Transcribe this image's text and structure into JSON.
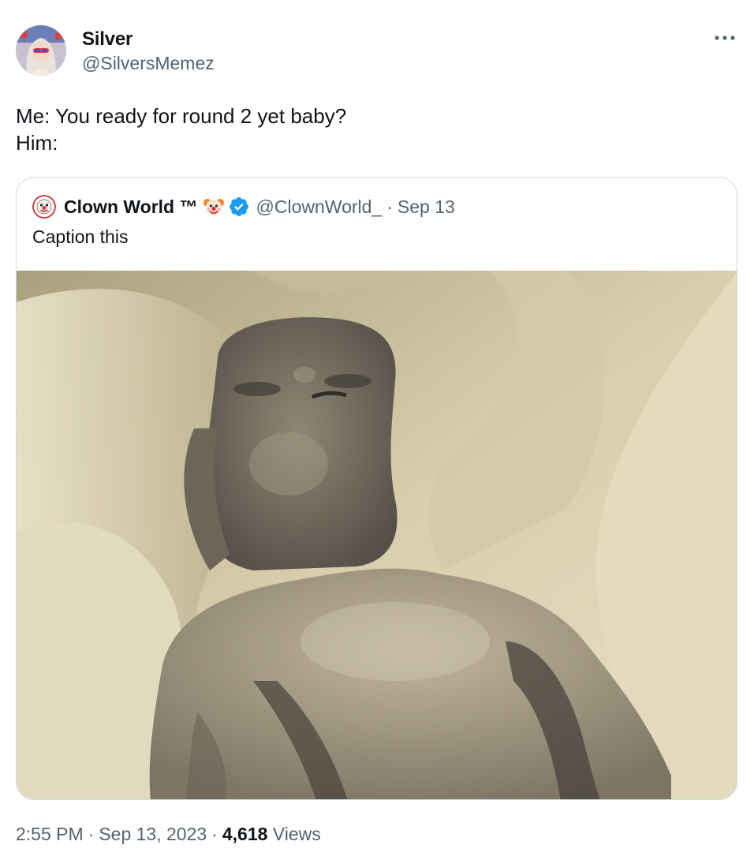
{
  "author": {
    "display_name": "Silver",
    "handle": "@SilversMemez",
    "avatar_icon": "user-avatar"
  },
  "menu": {
    "more_icon": "more-horizontal-icon"
  },
  "tweet": {
    "lines": [
      "Me: You ready for round 2 yet baby?",
      "Him:"
    ]
  },
  "quoted": {
    "display_name": "Clown World ™",
    "emoji_icon": "clown-face-emoji",
    "verified_icon": "verified-badge-icon",
    "handle": "@ClownWorld_",
    "separator": "·",
    "date": "Sep 13",
    "text": "Caption this",
    "media_icon": "photo-image"
  },
  "footer": {
    "time": "2:55 PM",
    "separator": "·",
    "date": "Sep 13, 2023",
    "views_count": "4,618",
    "views_label": "Views"
  },
  "colors": {
    "text_primary": "#0f1419",
    "text_secondary": "#536471",
    "border": "#cfd9de",
    "verified": "#1d9bf0",
    "background": "#ffffff"
  }
}
